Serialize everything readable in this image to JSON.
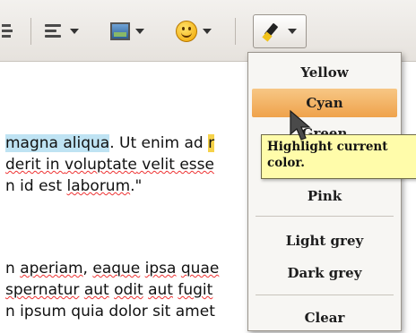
{
  "toolbar": {
    "buttons": [
      "indent",
      "align-lines",
      "insert-image",
      "insert-smiley",
      "text-highlight"
    ]
  },
  "document": {
    "line1": {
      "cyan_text": "magna aliqua",
      "mid_text": ". Ut enim ad ",
      "yellow_text": "r"
    },
    "line2": {
      "text_a": "derit in ",
      "text_b": "voluptate",
      "text_c": " velit esse"
    },
    "line3": {
      "text_a": "n id est ",
      "text_b": "laborum",
      "text_c": ".\""
    },
    "line4": {
      "text_a": "n ",
      "text_b": "aperiam",
      "text_c": ", ",
      "text_d": "eaque",
      "text_e": " ",
      "text_f": "ipsa",
      "text_g": " ",
      "text_h": "quae"
    },
    "line5": {
      "text_a": "spernatur",
      "text_b": " ",
      "text_c": "aut",
      "text_d": " ",
      "text_e": "odit",
      "text_f": " ",
      "text_g": "aut",
      "text_h": " ",
      "text_i": "fugit"
    },
    "line6": {
      "text_a": "n ipsum quia dolor sit amet"
    }
  },
  "highlight_menu": {
    "items": [
      "Yellow",
      "Cyan",
      "Green",
      "Pink",
      "Light grey",
      "Dark grey",
      "Clear"
    ],
    "active": "Cyan"
  },
  "tooltip": {
    "line1": "Highlight current",
    "line2": "color."
  },
  "colors": {
    "menu_active": "#f0a64f",
    "tooltip_bg": "#fffcaa",
    "cyan_highlight": "#bfe3f3",
    "yellow_highlight": "#f6d24a"
  }
}
